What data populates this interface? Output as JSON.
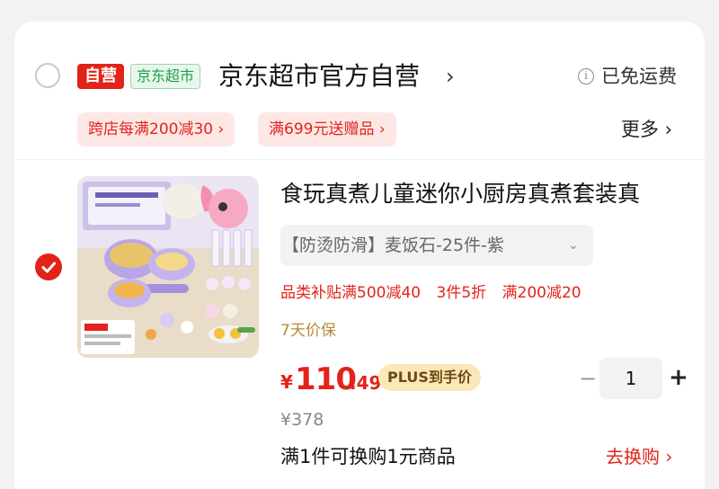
{
  "colors": {
    "brand_red": "#e2231a",
    "jd_green": "#18a34a",
    "plus_gold": "#fbe8b8"
  },
  "shop": {
    "tag_self": "自营",
    "tag_market": "京东超市",
    "name": "京东超市官方自营",
    "arrow": "›",
    "shipping_icon": "info-icon",
    "shipping_text": "已免运费",
    "coupons": [
      "跨店每满200减30 ›",
      "满699元送赠品 ›"
    ],
    "more": "更多 ›"
  },
  "item": {
    "selected": true,
    "image": "kids-mini-kitchen-cookware-set",
    "title": "食玩真煮儿童迷你小厨房真煮套装真",
    "spec": "【防烫防滑】麦饭石-25件-紫",
    "spec_caret": "⌄",
    "promotions": [
      "品类补贴满500减40",
      "3件5折",
      "满200减20"
    ],
    "guarantee": "7天价保",
    "price_symbol": "¥",
    "price_integer": "110",
    "price_decimal": ".49",
    "plus_label": "PLUS到手价",
    "original_price": "¥378",
    "quantity": "1",
    "minus": "−",
    "plus": "+",
    "exchange_text": "满1件可换购1元商品",
    "exchange_link": "去换购 ›"
  }
}
